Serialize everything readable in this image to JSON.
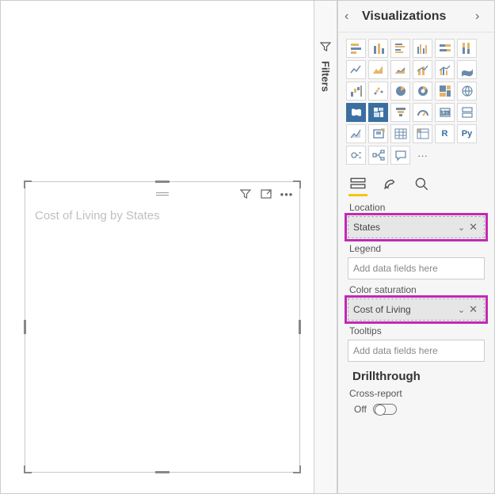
{
  "canvas": {
    "visual_title": "Cost of Living by States",
    "header_icons": [
      "filter-icon",
      "focus-mode-icon",
      "more-icon"
    ]
  },
  "filters_strip": {
    "label": "Filters"
  },
  "viz_pane": {
    "title": "Visualizations",
    "gallery_selected": "filled-map",
    "tabs": {
      "fields": "Fields",
      "format": "Format",
      "analytics": "Analytics",
      "active": "fields"
    },
    "wells": {
      "location": {
        "label": "Location",
        "value": "States",
        "has_value": true,
        "highlight": true
      },
      "legend": {
        "label": "Legend",
        "placeholder": "Add data fields here",
        "has_value": false,
        "highlight": false
      },
      "color_saturation": {
        "label": "Color saturation",
        "value": "Cost of Living",
        "has_value": true,
        "highlight": true
      },
      "tooltips": {
        "label": "Tooltips",
        "placeholder": "Add data fields here",
        "has_value": false,
        "highlight": false
      }
    },
    "drillthrough": {
      "title": "Drillthrough",
      "cross_report_label": "Cross-report",
      "cross_report_state": "Off"
    },
    "py_label": "Py",
    "r_label": "R",
    "ellipsis": "···"
  }
}
